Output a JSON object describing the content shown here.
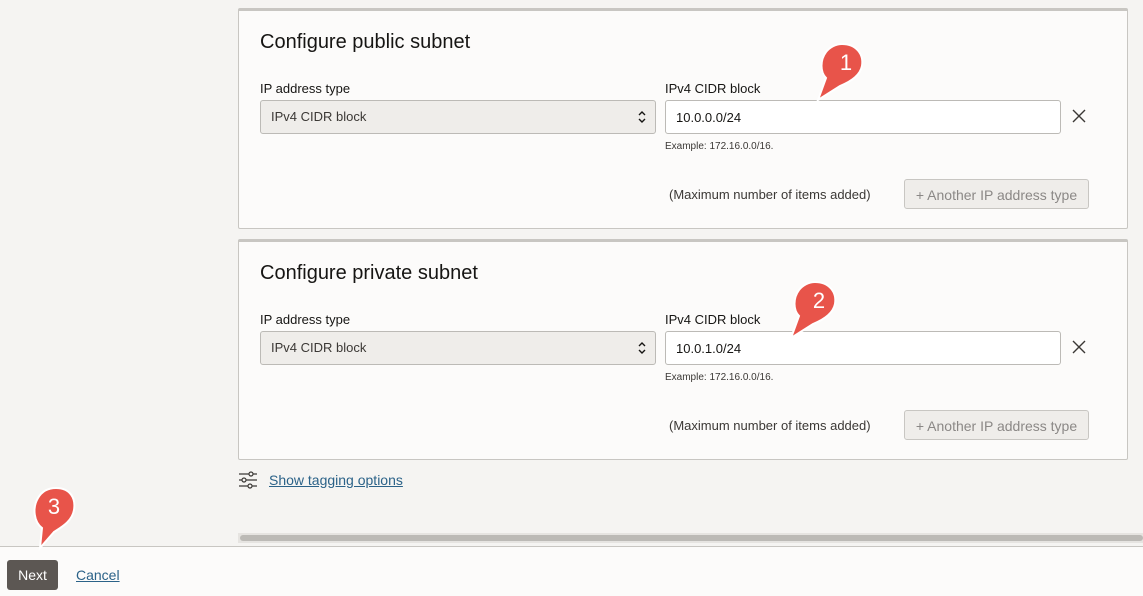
{
  "public_subnet": {
    "title": "Configure public subnet",
    "ip_type_label": "IP address type",
    "ip_type_value": "IPv4 CIDR block",
    "cidr_label": "IPv4 CIDR block",
    "cidr_value": "10.0.0.0/24",
    "example": "Example: 172.16.0.0/16.",
    "max_note": "(Maximum number of items added)",
    "another_button": "+ Another IP address type"
  },
  "private_subnet": {
    "title": "Configure private subnet",
    "ip_type_label": "IP address type",
    "ip_type_value": "IPv4 CIDR block",
    "cidr_label": "IPv4 CIDR block",
    "cidr_value": "10.0.1.0/24",
    "example": "Example: 172.16.0.0/16.",
    "max_note": "(Maximum number of items added)",
    "another_button": "+ Another IP address type"
  },
  "tagging": {
    "link": "Show tagging options",
    "icon": "sliders-icon"
  },
  "footer": {
    "next_label": "Next",
    "cancel_label": "Cancel"
  },
  "callouts": [
    "1",
    "2",
    "3"
  ],
  "colors": {
    "callout": "#e8544a",
    "link": "#2b6288",
    "primary_button": "#5c5753"
  }
}
